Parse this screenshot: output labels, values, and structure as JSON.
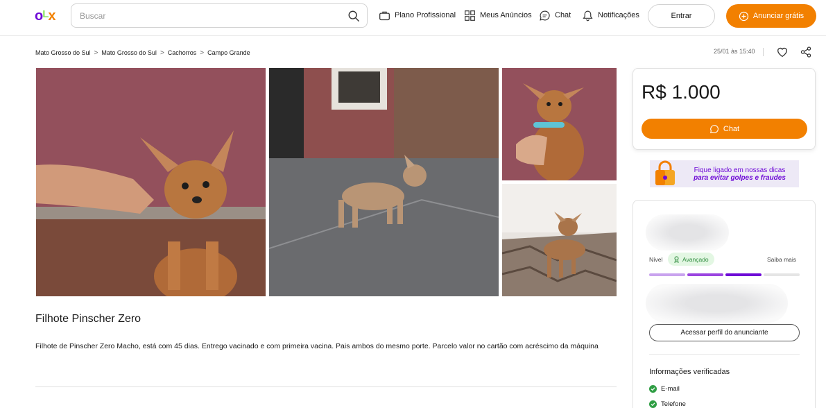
{
  "header": {
    "logo": {
      "o": "o",
      "l": "L",
      "x": "x"
    },
    "search_placeholder": "Buscar",
    "nav": {
      "plano": "Plano Profissional",
      "anuncios": "Meus Anúncios",
      "chat": "Chat",
      "notificacoes": "Notificações"
    },
    "entrar": "Entrar",
    "anunciar": "Anunciar grátis"
  },
  "breadcrumb": [
    "Mato Grosso do Sul",
    "Mato Grosso do Sul",
    "Cachorros",
    "Campo Grande"
  ],
  "breadcrumb_separator": ">",
  "published": "25/01 às 15:40",
  "listing": {
    "title": "Filhote Pinscher Zero",
    "description": "Filhote de Pinscher Zero Macho, está com 45 dias. Entrego vacinado e com primeira vacina. Pais ambos do mesmo porte. Parcelo valor no cartão com acréscimo da máquina"
  },
  "price_card": {
    "price": "R$ 1.000",
    "chat_button": "Chat"
  },
  "safety_banner": {
    "line1": "Fique ligado em nossas dicas",
    "line2": "para evitar golpes e fraudes"
  },
  "seller": {
    "level_label": "Nível",
    "level_badge": "Avançado",
    "learn_more": "Saiba mais",
    "level_progress_filled_segments": 3,
    "level_progress_total_segments": 4,
    "profile_button": "Acessar perfil do anunciante",
    "verified_title": "Informações verificadas",
    "verified_items": [
      "E-mail",
      "Telefone"
    ]
  },
  "colors": {
    "brand_orange": "#f28000",
    "brand_purple": "#6e0ad6",
    "verified_green": "#2f9e44"
  }
}
